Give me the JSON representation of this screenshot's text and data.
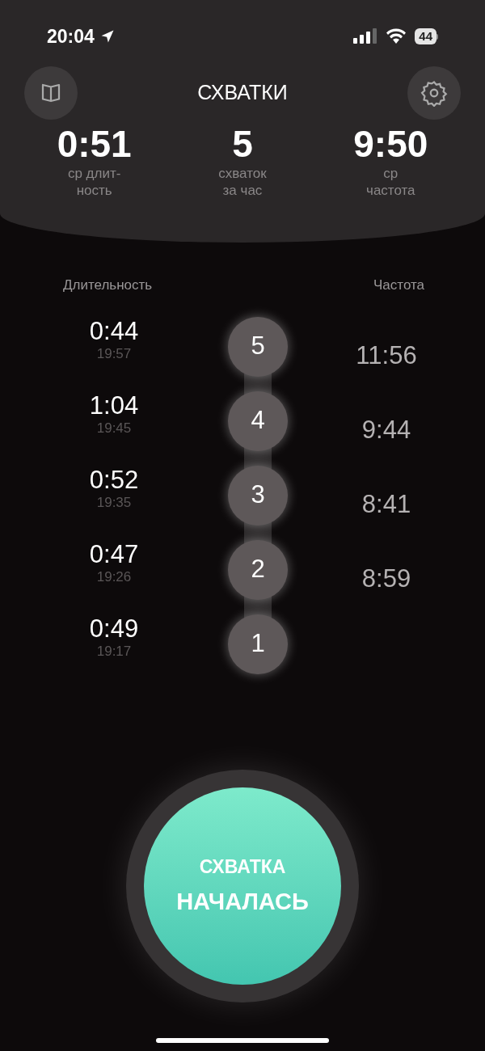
{
  "status_bar": {
    "time": "20:04",
    "battery": "44"
  },
  "header": {
    "title": "СХВАТКИ"
  },
  "stats": [
    {
      "value": "0:51",
      "label": "ср длит-ность"
    },
    {
      "value": "5",
      "label": "схваток за час"
    },
    {
      "value": "9:50",
      "label": "ср частота"
    }
  ],
  "columns": {
    "duration_heading": "Длительность",
    "frequency_heading": "Частота"
  },
  "contractions": [
    {
      "number": "5",
      "duration": "0:44",
      "start_time": "19:57"
    },
    {
      "number": "4",
      "duration": "1:04",
      "start_time": "19:45"
    },
    {
      "number": "3",
      "duration": "0:52",
      "start_time": "19:35"
    },
    {
      "number": "2",
      "duration": "0:47",
      "start_time": "19:26"
    },
    {
      "number": "1",
      "duration": "0:49",
      "start_time": "19:17"
    }
  ],
  "frequencies": [
    "11:56",
    "9:44",
    "8:41",
    "8:59"
  ],
  "start_button": {
    "line_1": "СХВАТКА",
    "line_2": "НАЧАЛАСЬ"
  }
}
